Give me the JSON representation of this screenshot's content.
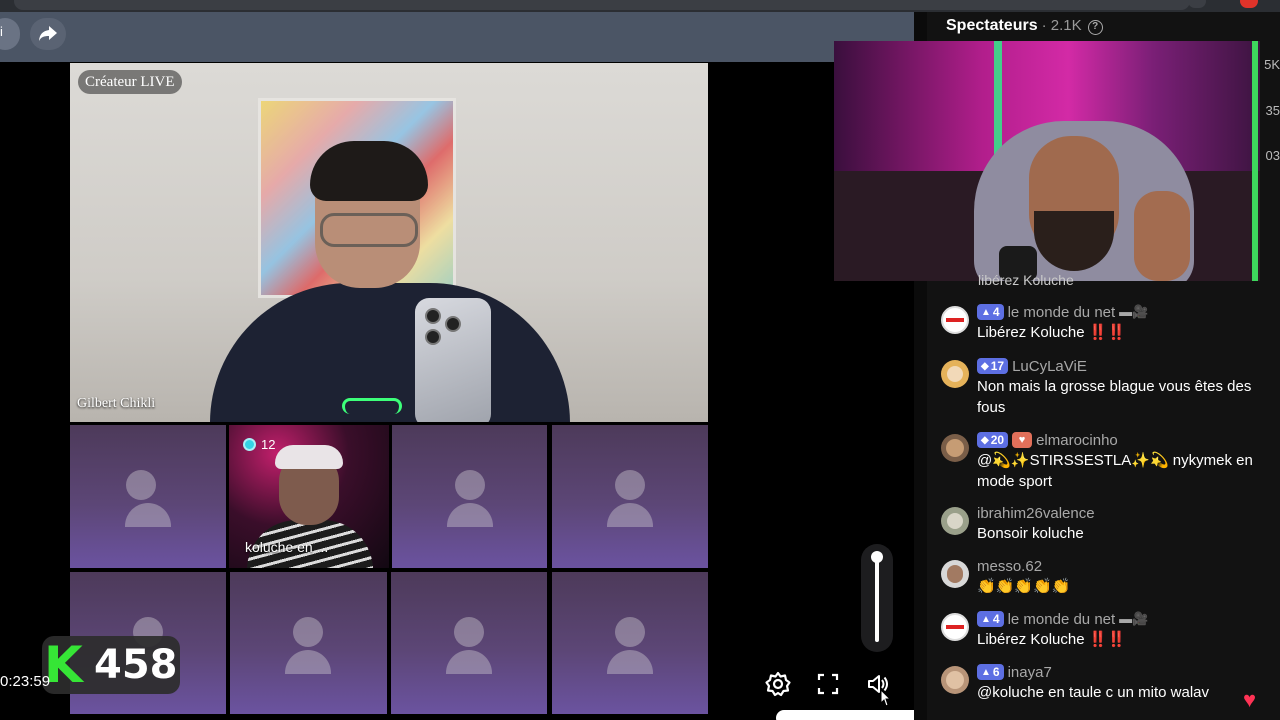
{
  "toolbar": {
    "back_label": "i",
    "share_icon": "share-arrow-icon"
  },
  "host": {
    "creator_label": "Créateur LIVE",
    "name": "Gilbert Chikli"
  },
  "guest": {
    "badge_count": "12",
    "label": "koluche en ..."
  },
  "counter": {
    "value": "458",
    "logo": "K",
    "timer": "0:23:59"
  },
  "viewers": {
    "title": "Spectateurs",
    "count": "· 2.1K",
    "info_icon": "?"
  },
  "edge_numbers": [
    "5K",
    "35",
    "03"
  ],
  "streamer_cut_text": "libérez Koluche",
  "chat": [
    {
      "level": "4",
      "level_style": "triangle",
      "user": "le monde du net",
      "deco": "▬🎥",
      "text": "Libérez Koluche",
      "suffix": "‼️‼️",
      "avatar": "mdn"
    },
    {
      "level": "17",
      "level_style": "diamond",
      "user": "LuCyLaViE",
      "deco": "",
      "text": "Non mais la grosse blague vous êtes des fous",
      "suffix": "",
      "avatar": "lucy"
    },
    {
      "level": "20",
      "level_style": "diamond",
      "user": "elmarocinho",
      "deco": "",
      "fan": "♥",
      "text": "@💫✨STIRSSESTLA✨💫 nykymek en mode sport",
      "suffix": "",
      "avatar": "elma"
    },
    {
      "level": "",
      "user": "ibrahim26valence",
      "deco": "",
      "text": "Bonsoir koluche",
      "suffix": "",
      "avatar": "ibra"
    },
    {
      "level": "",
      "user": "messo.62",
      "deco": "",
      "text": "👏👏👏👏👏",
      "suffix": "",
      "avatar": "messo"
    },
    {
      "level": "4",
      "level_style": "triangle",
      "user": "le monde du net",
      "deco": "▬🎥",
      "text": "Libérez Koluche",
      "suffix": "‼️‼️",
      "avatar": "mdn"
    },
    {
      "level": "6",
      "level_style": "triangle",
      "user": "inaya7",
      "deco": "",
      "text": "@koluche en taule c un mito walav",
      "suffix": "",
      "avatar": "inaya"
    }
  ],
  "controls": {
    "settings_icon": "gear-icon",
    "fullscreen_icon": "fullscreen-icon",
    "volume_icon": "speaker-icon",
    "volume_level": 0.95
  },
  "colors": {
    "accent": "#5d6fe3",
    "counter_green": "#36e536",
    "alert_red": "#e03030"
  }
}
